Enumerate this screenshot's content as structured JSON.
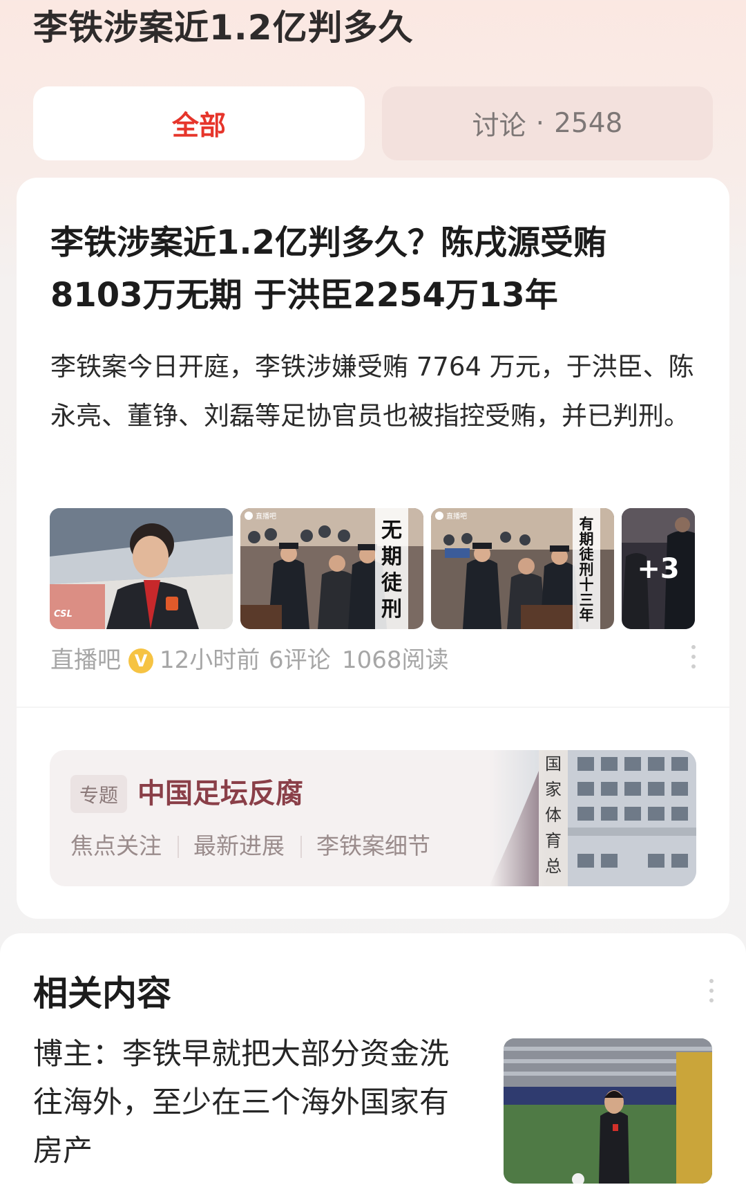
{
  "page": {
    "title": "李铁涉案近1.2亿判多久"
  },
  "tabs": [
    {
      "label": "全部"
    },
    {
      "label": "讨论",
      "count": "2548",
      "separator": "·"
    }
  ],
  "article": {
    "title": "李铁涉案近1.2亿判多久？陈戌源受贿8103万无期 于洪臣2254万13年",
    "summary": "李铁案今日开庭，李铁涉嫌受贿 7764 万元，于洪臣、陈永亮、董铮、刘磊等足协官员也被指控受贿，并已判刑。",
    "images": [
      {
        "alt": "李铁",
        "badge": "CSL"
      },
      {
        "alt": "庭审画面",
        "source": "直播吧",
        "overlay": "无期徒刑"
      },
      {
        "alt": "庭审画面",
        "source": "直播吧",
        "overlay": "有期徒刑十三年"
      },
      {
        "alt": "更多图片",
        "more": "+3"
      }
    ],
    "meta": {
      "source": "直播吧",
      "verified": "V",
      "time": "12小时前",
      "comments": "6评论",
      "reads": "1068阅读"
    }
  },
  "topic": {
    "tag": "专题",
    "title": "中国足坛反腐",
    "links": [
      "焦点关注",
      "最新进展",
      "李铁案细节"
    ],
    "image_text": "国家体育总"
  },
  "related": {
    "title": "相关内容",
    "items": [
      {
        "headline": "博主：李铁早就把大部分资金洗往海外，至少在三个海外国家有房产"
      }
    ]
  },
  "colors": {
    "accent": "#e6352b",
    "topic_title": "#8a3f48",
    "verified": "#f6c343"
  }
}
